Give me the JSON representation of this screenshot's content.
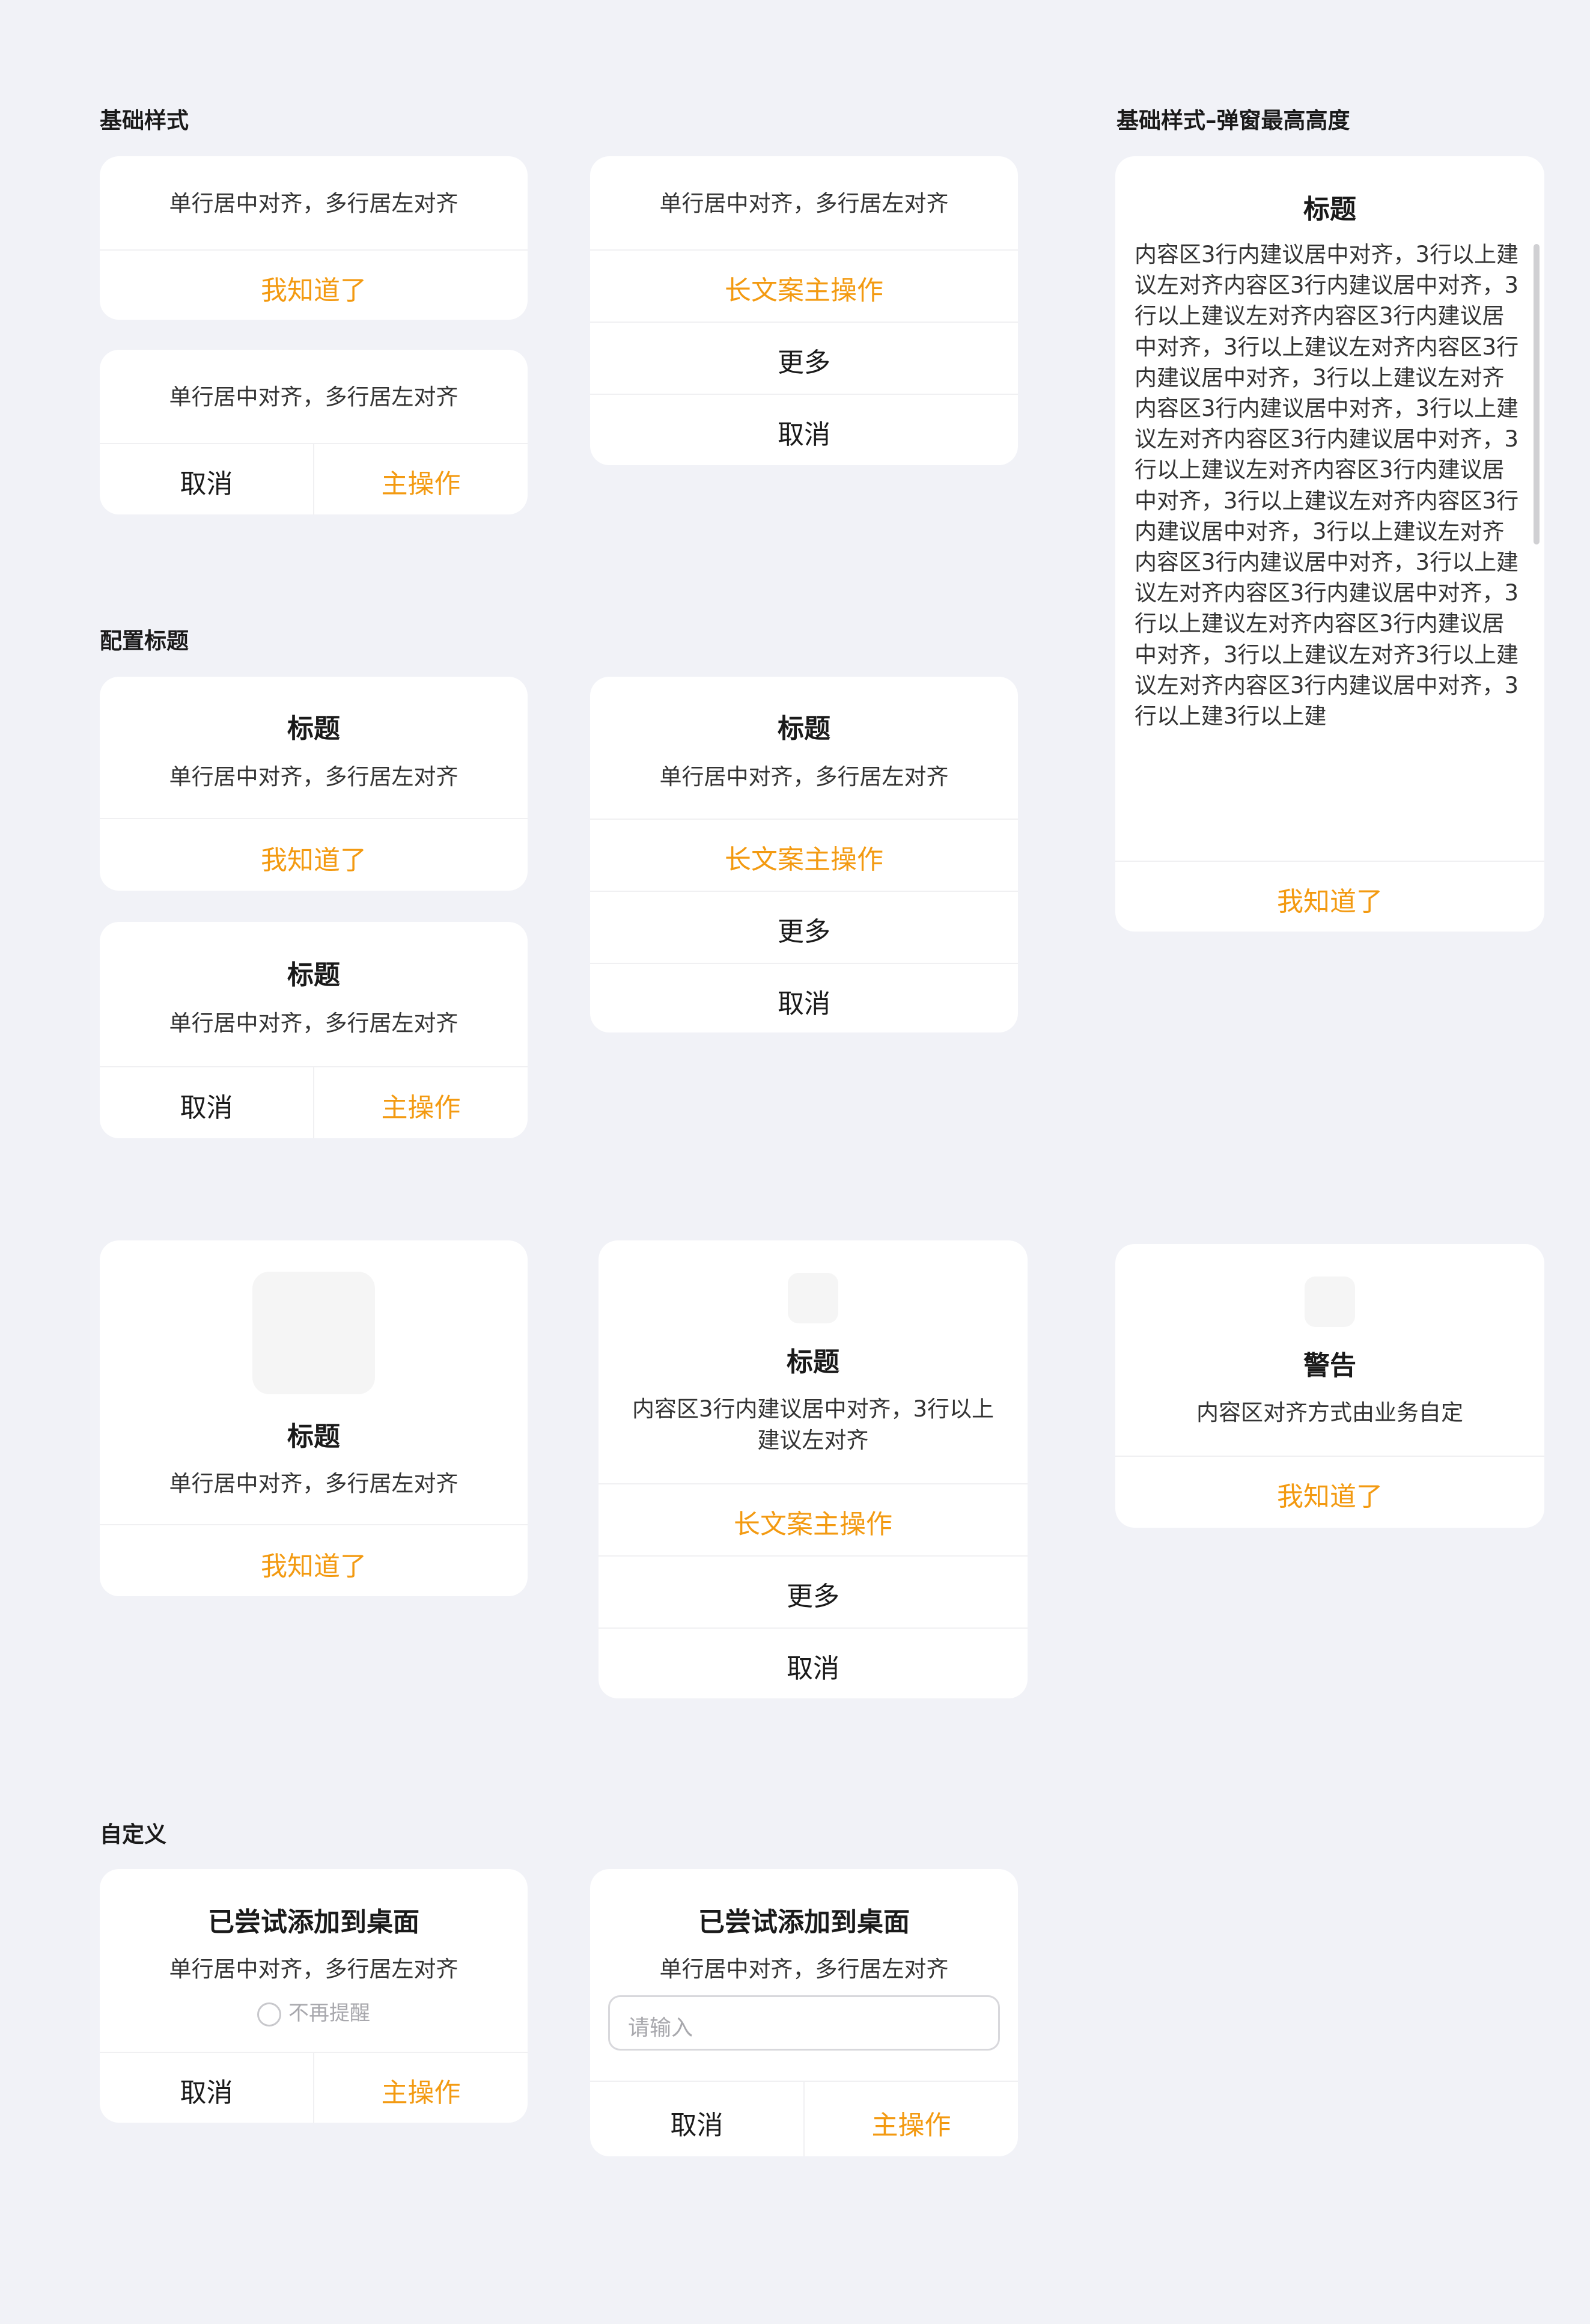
{
  "sections": {
    "basic": "基础样式",
    "basic_max_height": "基础样式–弹窗最高高度",
    "with_title": "配置标题",
    "custom": "自定义"
  },
  "texts": {
    "single_center_multi_left": "单行居中对齐，多行居左对齐",
    "title": "标题",
    "warning": "警告",
    "content_align_custom": "内容区对齐方式由业务自定",
    "content_3lines_1": "内容区3行内建议居中对齐，3行以上",
    "content_3lines_2": "建议左对齐",
    "long_content": "内容区3行内建议居中对齐，3行以上建议左对齐内容区3行内建议居中对齐，3行以上建议左对齐内容区3行内建议居中对齐，3行以上建议左对齐内容区3行内建议居中对齐，3行以上建议左对齐内容区3行内建议居中对齐，3行以上建议左对齐内容区3行内建议居中对齐，3行以上建议左对齐内容区3行内建议居中对齐，3行以上建议左对齐内容区3行内建议居中对齐，3行以上建议左对齐内容区3行内建议居中对齐，3行以上建议左对齐内容区3行内建议居中对齐，3行以上建议左对齐内容区3行内建议居中对齐，3行以上建议左对齐3行以上建议左对齐内容区3行内建议居中对齐，3行以上建3行以上建",
    "added_to_desktop": "已尝试添加到桌面",
    "dont_remind": "不再提醒",
    "input_placeholder": "请输入"
  },
  "buttons": {
    "got_it": "我知道了",
    "cancel": "取消",
    "primary": "主操作",
    "long_primary": "长文案主操作",
    "more": "更多"
  },
  "colors": {
    "accent": "#F39A11",
    "background": "#F1F2F7",
    "card": "#FFFFFF",
    "text": "#1A1A1A"
  },
  "icons": {
    "image_placeholder": "image-placeholder-icon",
    "radio": "radio-circle-icon"
  }
}
